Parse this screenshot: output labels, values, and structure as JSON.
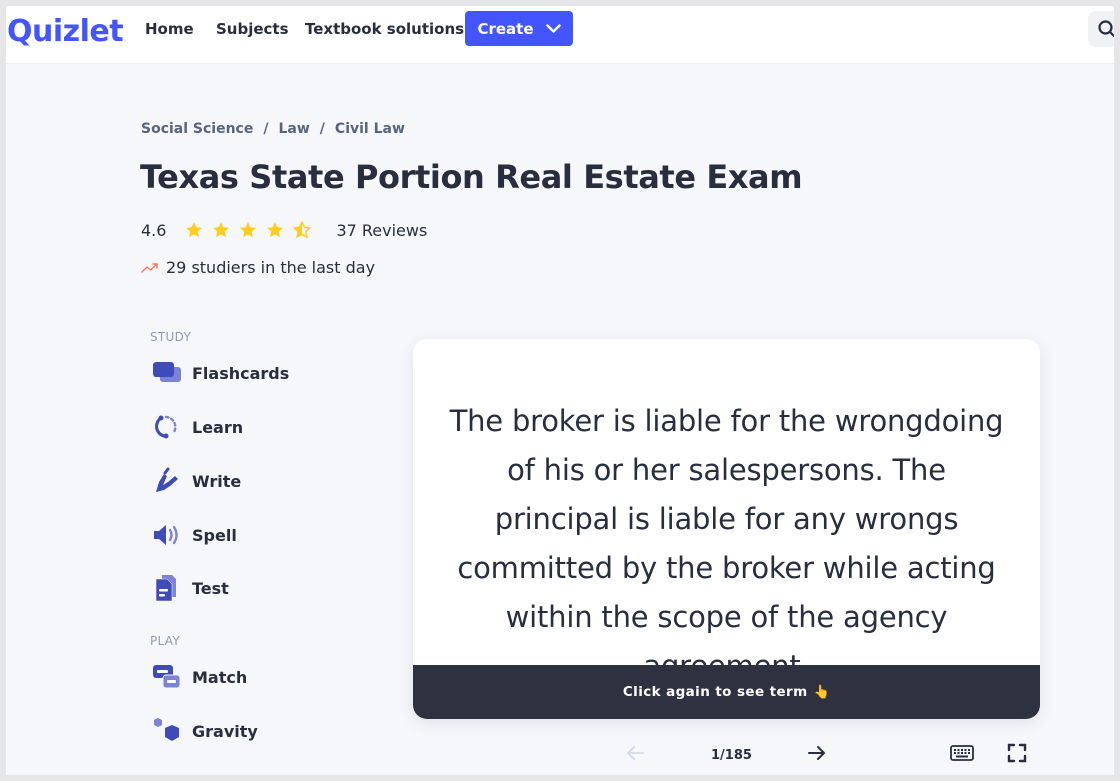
{
  "header": {
    "logo": "Quizlet",
    "nav": [
      {
        "label": "Home"
      },
      {
        "label": "Subjects"
      },
      {
        "label": "Textbook solutions"
      }
    ],
    "create_label": "Create",
    "brand_color": "#4255ff",
    "search_icon": "search-icon"
  },
  "breadcrumb": {
    "items": [
      "Social Science",
      "Law",
      "Civil Law"
    ],
    "separator": "/"
  },
  "set": {
    "title": "Texas State Portion Real Estate Exam",
    "rating": "4.6",
    "rating_value": 4.6,
    "rating_max": 5,
    "reviews": "37 Reviews",
    "studiers": "29 studiers in the last day",
    "star_color": "#ffcd1f",
    "trend_color": "#ff725b"
  },
  "sidebar": {
    "study_label": "STUDY",
    "study": [
      {
        "label": "Flashcards",
        "icon": "flashcards-icon"
      },
      {
        "label": "Learn",
        "icon": "learn-icon"
      },
      {
        "label": "Write",
        "icon": "write-icon"
      },
      {
        "label": "Spell",
        "icon": "spell-icon"
      },
      {
        "label": "Test",
        "icon": "test-icon"
      }
    ],
    "play_label": "PLAY",
    "play": [
      {
        "label": "Match",
        "icon": "match-icon"
      },
      {
        "label": "Gravity",
        "icon": "gravity-icon"
      }
    ]
  },
  "flashcard": {
    "definition": "The broker is liable for the wrongdoing of his or her salespersons. The principal is liable for any wrongs committed by the broker while acting within the scope of the agency agreement.",
    "footer": "Click again to see term",
    "footer_emoji": "👆"
  },
  "controls": {
    "counter": "1/185",
    "current": 1,
    "total": 185,
    "prev_icon": "arrow-left-icon",
    "next_icon": "arrow-right-icon",
    "keyboard_icon": "keyboard-icon",
    "fullscreen_icon": "fullscreen-icon"
  }
}
